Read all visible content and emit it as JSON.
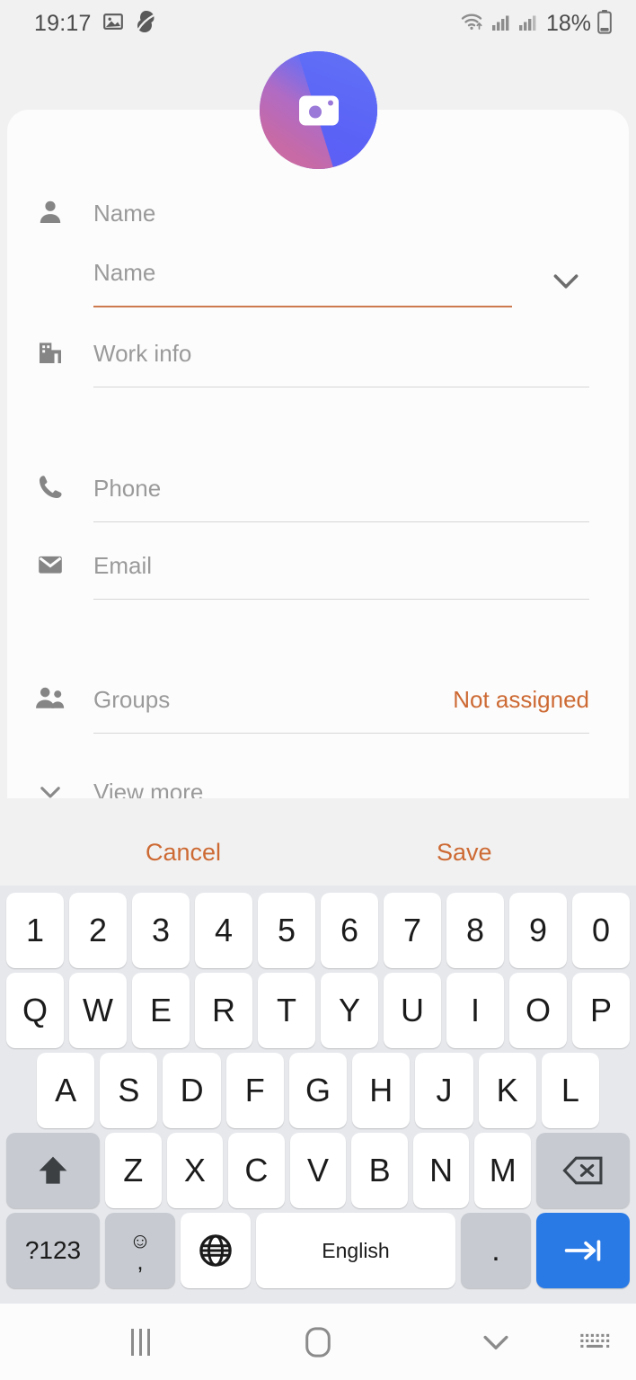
{
  "status_bar": {
    "time": "19:17",
    "battery_percent": "18%",
    "icons": [
      "image-icon",
      "app-icon",
      "wifi-icon",
      "signal-icon",
      "signal-icon-2",
      "battery-icon"
    ]
  },
  "avatar": {
    "icon": "camera-icon",
    "colors": {
      "blue": "#5a66f5",
      "purple": "#a569d0",
      "pink": "#c76aa6"
    }
  },
  "form": {
    "fields": [
      {
        "key": "name_section",
        "icon": "person-icon",
        "label": "Name",
        "value": "",
        "underline": false
      },
      {
        "key": "name_input",
        "icon": "",
        "label": "Name",
        "value": "",
        "underline": true,
        "active": true,
        "expand_icon": "chevron-down-icon"
      },
      {
        "key": "work_info",
        "icon": "building-icon",
        "label": "Work info",
        "value": "",
        "underline": true
      },
      {
        "key": "phone",
        "icon": "phone-icon",
        "label": "Phone",
        "value": "",
        "underline": true
      },
      {
        "key": "email",
        "icon": "envelope-icon",
        "label": "Email",
        "value": "",
        "underline": true
      },
      {
        "key": "groups",
        "icon": "people-icon",
        "label": "Groups",
        "value": "Not assigned",
        "underline": true
      },
      {
        "key": "view_more",
        "icon": "chevron-down-icon",
        "label": "View more",
        "value": "",
        "underline": false
      }
    ]
  },
  "actions": {
    "cancel_label": "Cancel",
    "save_label": "Save"
  },
  "keyboard": {
    "rows": {
      "numbers": [
        "1",
        "2",
        "3",
        "4",
        "5",
        "6",
        "7",
        "8",
        "9",
        "0"
      ],
      "top": [
        "Q",
        "W",
        "E",
        "R",
        "T",
        "Y",
        "U",
        "I",
        "O",
        "P"
      ],
      "home": [
        "A",
        "S",
        "D",
        "F",
        "G",
        "H",
        "J",
        "K",
        "L"
      ],
      "bottom": [
        "Z",
        "X",
        "C",
        "V",
        "B",
        "N",
        "M"
      ]
    },
    "shift_key": "shift-icon",
    "backspace_key": "backspace-icon",
    "symbols_key": "?123",
    "emoji_key": "emoji-icon",
    "comma_key": ",",
    "globe_key": "globe-icon",
    "space_key": "English",
    "period_key": ".",
    "enter_key": "next-field-icon",
    "enter_color": "#2a7ae6"
  },
  "nav_bar": {
    "recents": "recents-icon",
    "home": "home-icon",
    "back": "collapse-keyboard-icon",
    "keyboard_toggle": "keyboard-icon"
  },
  "theme": {
    "accent": "#cd6a34",
    "underline_active": "#cd7a4e",
    "page_bg": "#f1f1f1",
    "card_bg": "#fcfcfc",
    "keyboard_bg": "#e6e8ec"
  }
}
